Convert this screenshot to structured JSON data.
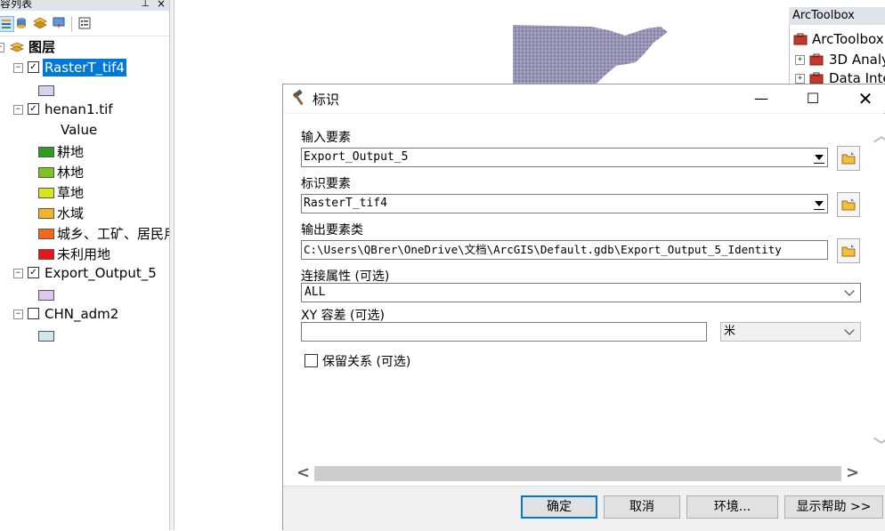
{
  "toc": {
    "title": "容列表",
    "root_label": "图层",
    "layers": [
      {
        "name": "RasterT_tif4",
        "checked": true,
        "selected": true,
        "swatch": "#d8d2f2"
      },
      {
        "name": "henan1.tif",
        "checked": true,
        "value_header": "Value",
        "classes": [
          {
            "label": "耕地",
            "color": "#2f9e1e"
          },
          {
            "label": "林地",
            "color": "#7cc41f"
          },
          {
            "label": "草地",
            "color": "#d5e61f"
          },
          {
            "label": "水域",
            "color": "#f0b72a"
          },
          {
            "label": "城乡、工矿、居民用",
            "color": "#f06a1a"
          },
          {
            "label": "未利用地",
            "color": "#e8141a"
          }
        ]
      },
      {
        "name": "Export_Output_5",
        "checked": true,
        "swatch": "#e0c6ee"
      },
      {
        "name": "CHN_adm2",
        "checked": false,
        "swatch": "#cfe6ee"
      }
    ]
  },
  "arctoolbox": {
    "title": "ArcToolbox",
    "items": [
      "ArcToolbox",
      "3D Analy",
      "Data Inte"
    ]
  },
  "dialog": {
    "title": "标识",
    "fields": {
      "input_label": "输入要素",
      "input_value": "Export_Output_5",
      "identity_label": "标识要素",
      "identity_value": "RasterT_tif4",
      "output_label": "输出要素类",
      "output_value": "C:\\Users\\QBrer\\OneDrive\\文档\\ArcGIS\\Default.gdb\\Export_Output_5_Identity",
      "join_label": "连接属性 (可选)",
      "join_value": "ALL",
      "xy_label": "XY 容差 (可选)",
      "xy_value": "",
      "xy_unit": "米",
      "keep_label": "保留关系 (可选)",
      "keep_checked": false
    },
    "buttons": {
      "ok": "确定",
      "cancel": "取消",
      "env": "环境...",
      "help": "显示帮助 >>"
    }
  },
  "colors": {
    "selection": "#0078d7",
    "titlebar": "#dfe3ea"
  }
}
